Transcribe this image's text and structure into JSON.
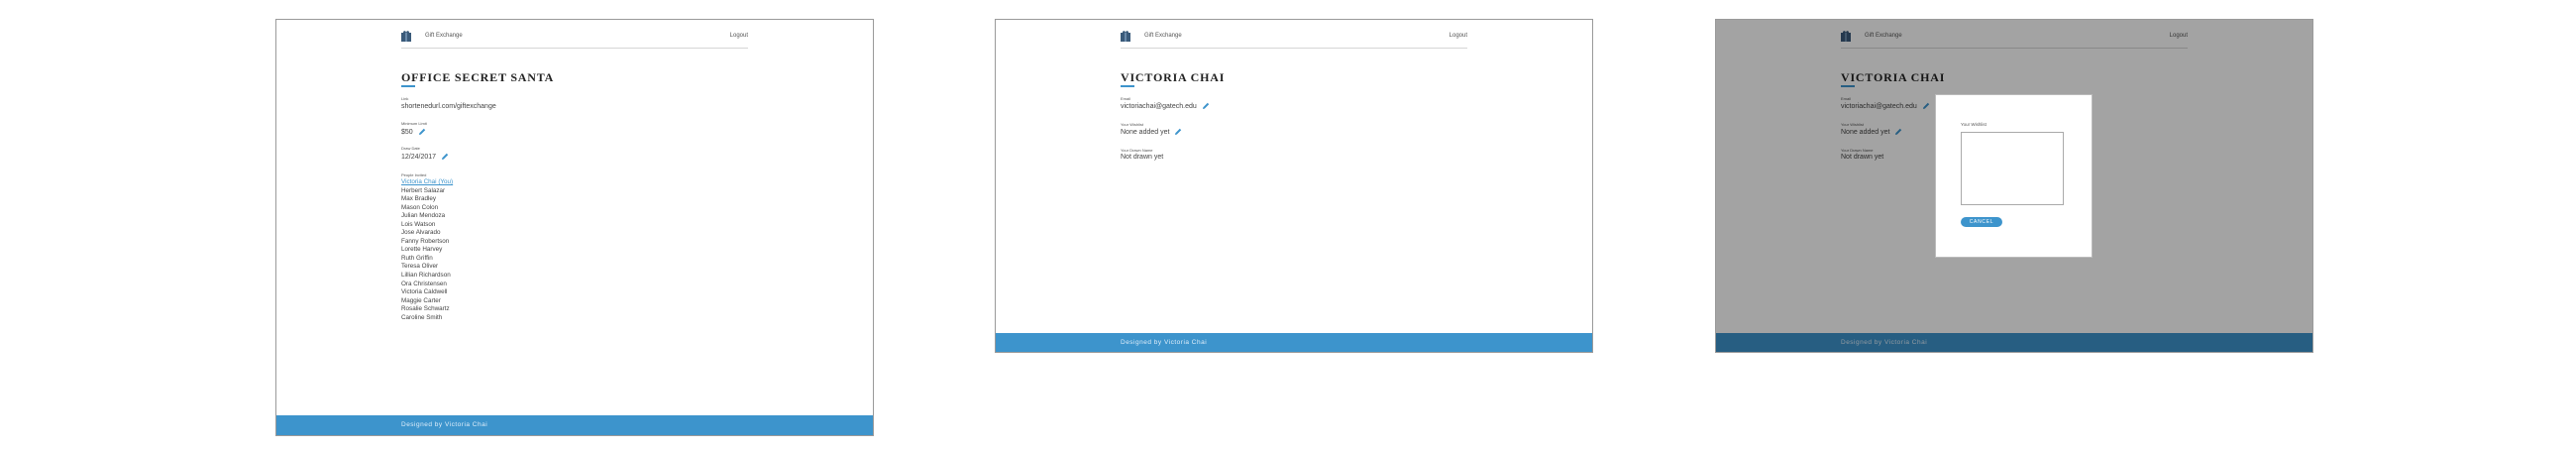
{
  "header": {
    "app_name": "Gift Exchange",
    "logout_label": "Logout"
  },
  "footer": {
    "text": "Designed by Victoria Chai"
  },
  "screen1": {
    "title": "OFFICE SECRET SANTA",
    "link_label": "Link",
    "link_value": "shortenedurl.com/giftexchange",
    "min_label": "Minimum Limit",
    "min_value": "$50",
    "draw_label": "Draw Date",
    "draw_value": "12/24/2017",
    "people_label": "People Invited",
    "people": [
      "Victoria Chai (You)",
      "Herbert Salazar",
      "Max Bradley",
      "Mason Colon",
      "Julian Mendoza",
      "Lois Watson",
      "Jose Alvarado",
      "Fanny Robertson",
      "Lorette Harvey",
      "Ruth Griffin",
      "Teresa Oliver",
      "Lillian Richardson",
      "Ora Christensen",
      "Victoria Caldwell",
      "Maggie Carter",
      "Rosalie Schwartz",
      "Caroline Smith"
    ]
  },
  "screen2": {
    "title": "VICTORIA CHAI",
    "email_label": "Email",
    "email_value": "victoriachai@gatech.edu",
    "wishlist_label": "Your Wishlist",
    "wishlist_value": "None added yet",
    "drawn_label": "Your Drawn Name",
    "drawn_value": "Not drawn yet"
  },
  "modal": {
    "label": "Your Wishlist",
    "cancel_label": "CANCEL"
  },
  "colors": {
    "accent": "#3d94cc",
    "overlay": "rgba(0,0,0,0.36)"
  }
}
